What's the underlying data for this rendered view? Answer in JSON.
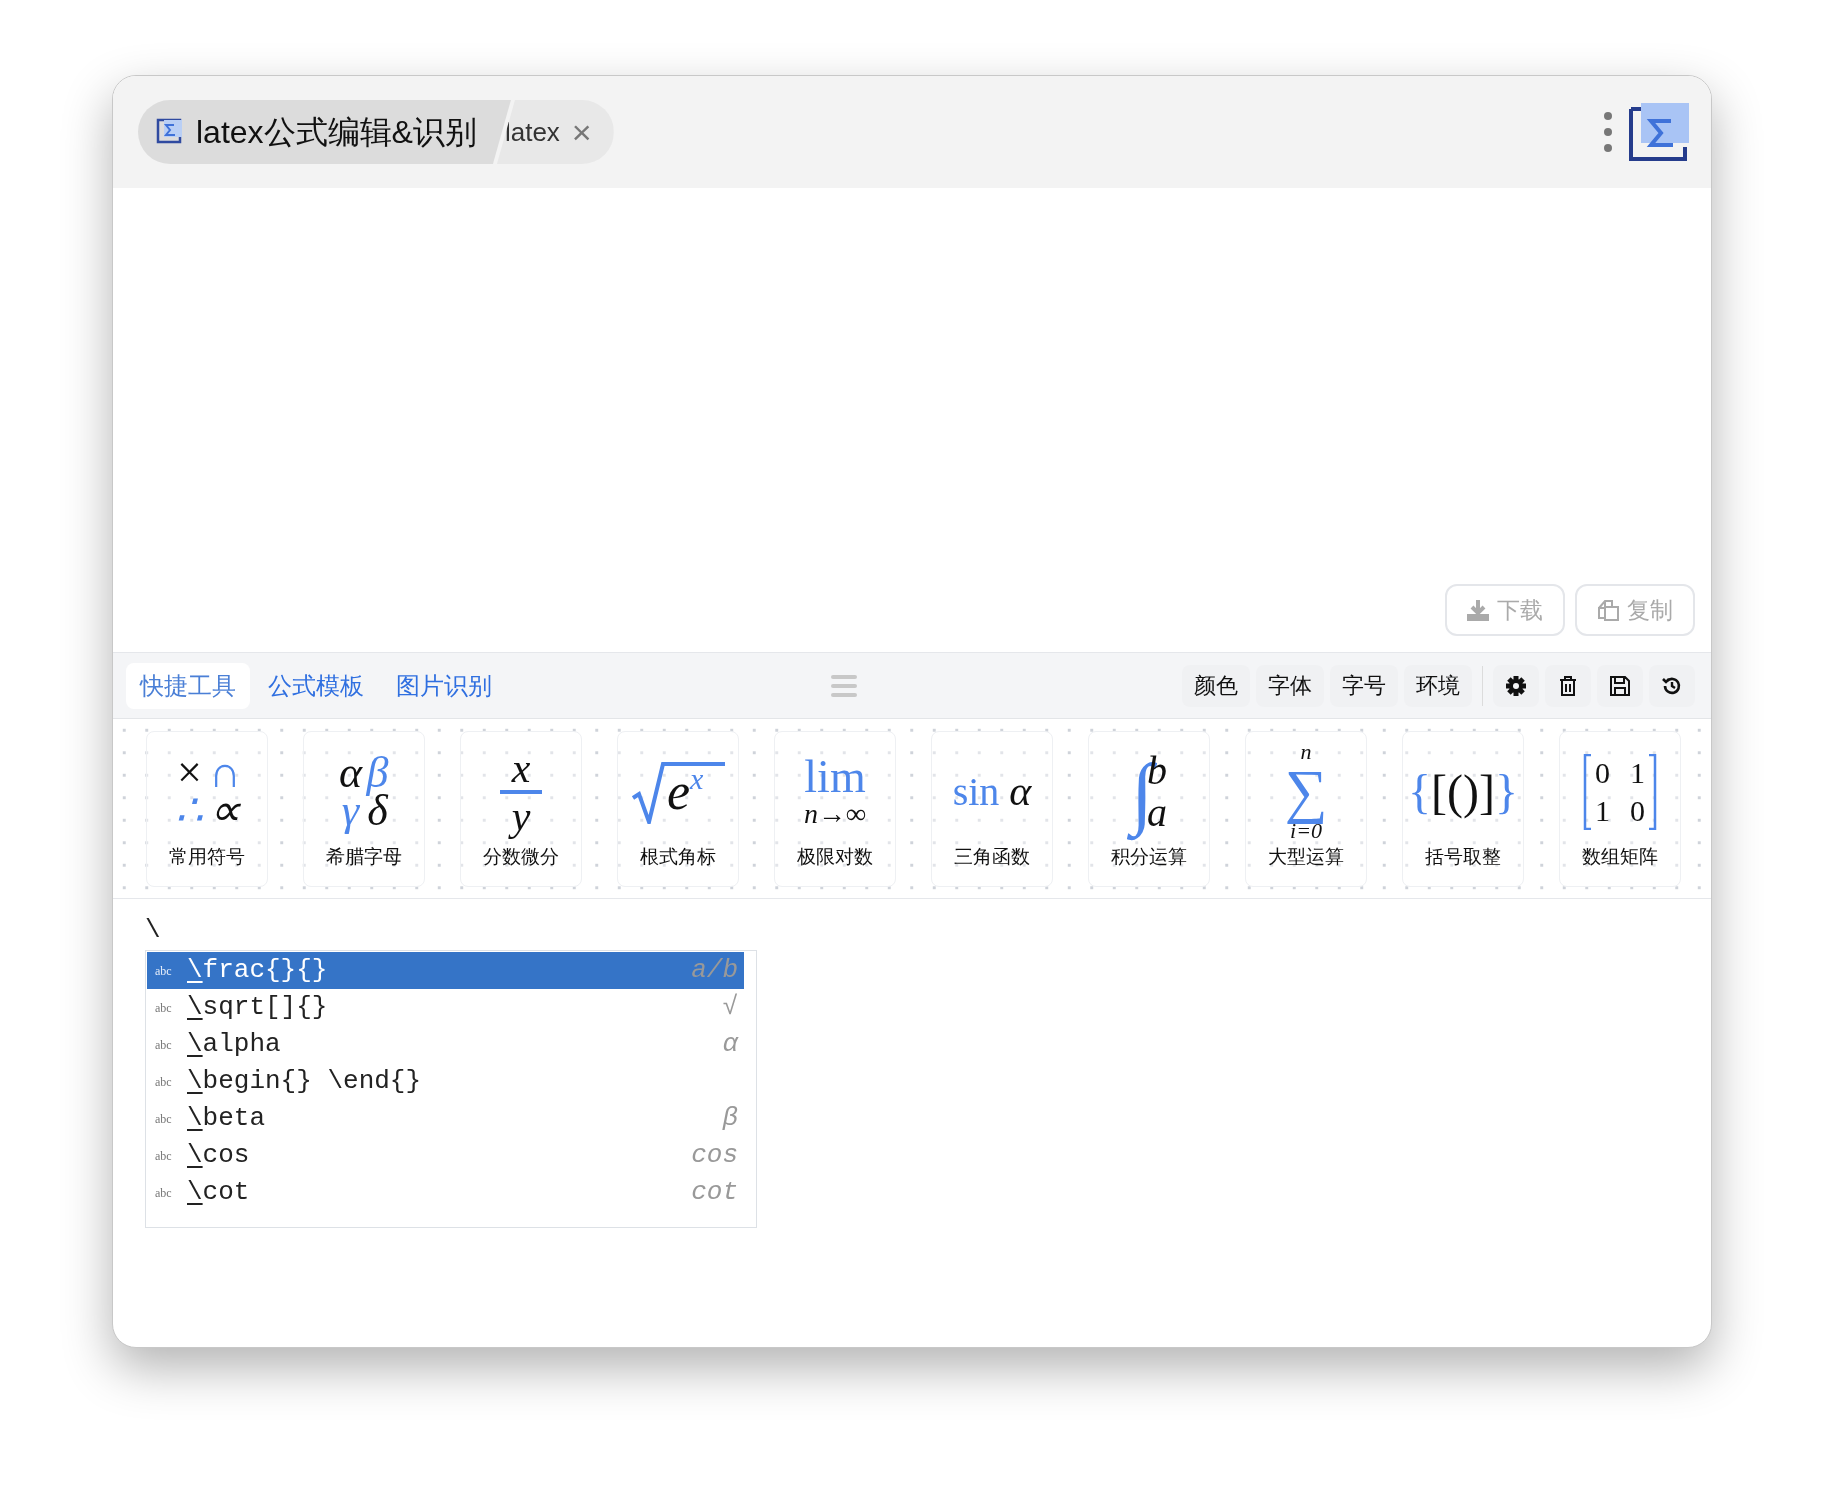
{
  "window": {
    "tabs": [
      {
        "label": "latex公式编辑&识别",
        "kind": "app",
        "selected": true
      },
      {
        "label": "latex",
        "kind": "doc",
        "selected": false,
        "close": "×"
      }
    ]
  },
  "preview": {
    "buttons": [
      {
        "label": "下载",
        "kind": "download"
      },
      {
        "label": "复制",
        "kind": "copy"
      }
    ]
  },
  "toolbar": {
    "tabs": [
      {
        "label": "快捷工具",
        "selected": true
      },
      {
        "label": "公式模板",
        "selected": false
      },
      {
        "label": "图片识别",
        "selected": false
      }
    ],
    "menus": [
      "颜色",
      "字体",
      "字号",
      "环境"
    ]
  },
  "tiles": [
    {
      "label": "常用符号",
      "kind": "grid",
      "parts": [
        "×",
        "∩",
        "∴",
        "∝"
      ]
    },
    {
      "label": "希腊字母",
      "kind": "grid",
      "parts": [
        "α",
        "β",
        "γ",
        "δ"
      ]
    },
    {
      "label": "分数微分",
      "kind": "fraction",
      "parts": [
        "x",
        "y"
      ]
    },
    {
      "label": "根式角标",
      "kind": "sqrt",
      "parts": [
        "e",
        "x"
      ]
    },
    {
      "label": "极限对数",
      "kind": "lim",
      "parts": [
        "lim",
        "n→∞"
      ]
    },
    {
      "label": "三角函数",
      "kind": "sin",
      "parts": [
        "sin",
        "α"
      ]
    },
    {
      "label": "积分运算",
      "kind": "integral",
      "parts": [
        "∫",
        "b",
        "a"
      ]
    },
    {
      "label": "大型运算",
      "kind": "sum",
      "parts": [
        "n",
        "∑",
        "i=0"
      ]
    },
    {
      "label": "括号取整",
      "kind": "brackets",
      "parts": [
        "{",
        "[",
        "(",
        ")",
        "]",
        "}"
      ]
    },
    {
      "label": "数组矩阵",
      "kind": "matrix",
      "parts": [
        "0",
        "1",
        "1",
        "0"
      ]
    }
  ],
  "editor": {
    "text": "\\"
  },
  "autocomplete": [
    {
      "tag": "abc",
      "text": "\\frac{}{}",
      "hint": "a/b",
      "selected": true
    },
    {
      "tag": "abc",
      "text": "\\sqrt[]{}",
      "hint": "√",
      "selected": false
    },
    {
      "tag": "abc",
      "text": "\\alpha",
      "hint": "α",
      "selected": false
    },
    {
      "tag": "abc",
      "text": "\\begin{} \\end{}",
      "selected": false
    },
    {
      "tag": "abc",
      "text": "\\beta",
      "hint": "β",
      "selected": false
    },
    {
      "tag": "abc",
      "text": "\\cos",
      "hint": "cos",
      "selected": false
    },
    {
      "tag": "abc",
      "text": "\\cot",
      "hint": "cot",
      "selected": false
    }
  ]
}
